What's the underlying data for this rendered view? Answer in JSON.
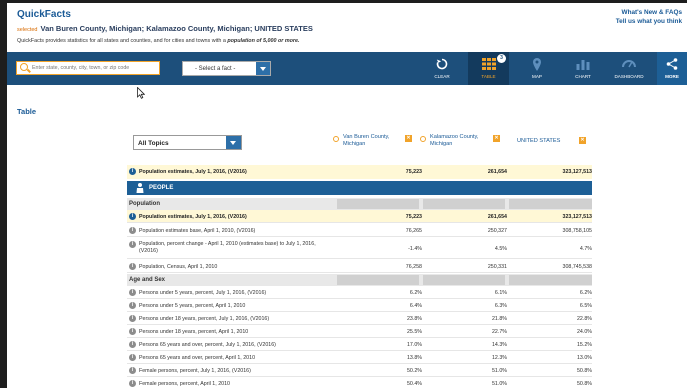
{
  "header": {
    "brand": "QuickFacts",
    "selected_label": "selected",
    "selected_places": "Van Buren County, Michigan; Kalamazoo County, Michigan; UNITED STATES",
    "intro_text": "QuickFacts provides statistics for all states and counties, and for cities and towns with a ",
    "intro_emphasis": "population of 5,000 or more.",
    "links": [
      "What's New & FAQs",
      "Tell us what you think"
    ]
  },
  "toolbar": {
    "search_placeholder": "Enter state, county, city, town, or zip code",
    "fact_select": "- Select a fact -",
    "buttons": [
      "CLEAR",
      "TABLE",
      "MAP",
      "CHART",
      "DASHBOARD",
      "MORE"
    ],
    "active": "TABLE",
    "table_badge": "3"
  },
  "table_heading": "Table",
  "topics_select": "All Topics",
  "columns": [
    {
      "name": "Van Buren County, Michigan"
    },
    {
      "name": "Kalamazoo County, Michigan"
    },
    {
      "name": "UNITED STATES"
    }
  ],
  "summary_row": {
    "label": "Population estimates, July 1, 2016, (V2016)",
    "values": [
      "75,223",
      "261,654",
      "323,127,513"
    ]
  },
  "people_label": "PEOPLE",
  "sections": [
    {
      "title": "Population",
      "rows": [
        {
          "label": "Population estimates, July 1, 2016, (V2016)",
          "values": [
            "75,223",
            "261,654",
            "323,127,513"
          ],
          "highlight": true
        },
        {
          "label": "Population estimates base, April 1, 2010, (V2016)",
          "values": [
            "76,265",
            "250,327",
            "308,758,105"
          ]
        },
        {
          "label": "Population, percent change - April 1, 2010 (estimates base) to July 1, 2016, (V2016)",
          "values": [
            "-1.4%",
            "4.5%",
            "4.7%"
          ],
          "tall": true
        },
        {
          "label": "Population, Census, April 1, 2010",
          "values": [
            "76,258",
            "250,331",
            "308,745,538"
          ]
        }
      ]
    },
    {
      "title": "Age and Sex",
      "rows": [
        {
          "label": "Persons under 5 years, percent, July 1, 2016, (V2016)",
          "values": [
            "6.2%",
            "6.1%",
            "6.2%"
          ]
        },
        {
          "label": "Persons under 5 years, percent, April 1, 2010",
          "values": [
            "6.4%",
            "6.3%",
            "6.5%"
          ]
        },
        {
          "label": "Persons under 18 years, percent, July 1, 2016, (V2016)",
          "values": [
            "23.8%",
            "21.8%",
            "22.8%"
          ]
        },
        {
          "label": "Persons under 18 years, percent, April 1, 2010",
          "values": [
            "25.5%",
            "22.7%",
            "24.0%"
          ]
        },
        {
          "label": "Persons 65 years and over, percent, July 1, 2016, (V2016)",
          "values": [
            "17.0%",
            "14.3%",
            "15.2%"
          ]
        },
        {
          "label": "Persons 65 years and over, percent, April 1, 2010",
          "values": [
            "13.8%",
            "12.3%",
            "13.0%"
          ]
        },
        {
          "label": "Female persons, percent, July 1, 2016, (V2016)",
          "values": [
            "50.2%",
            "51.0%",
            "50.8%"
          ]
        },
        {
          "label": "Female persons, percent, April 1, 2010",
          "values": [
            "50.4%",
            "51.0%",
            "50.8%"
          ]
        }
      ]
    }
  ],
  "colors": {
    "navy": "#1d4f7b",
    "accent": "#f1a32a",
    "highlight": "#fff8d6"
  }
}
